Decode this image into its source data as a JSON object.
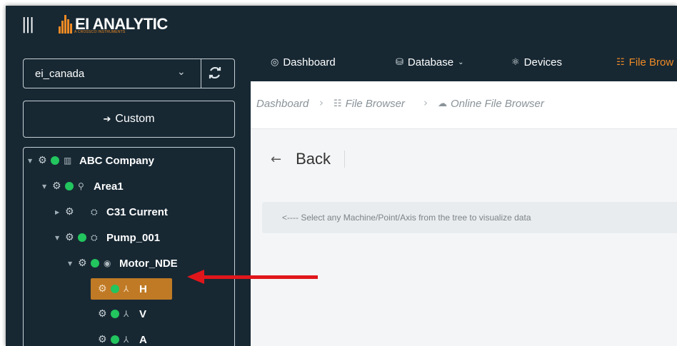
{
  "app": {
    "logo_text": "EI ANALYTIC",
    "logo_subtext": "A CROSSCO INSTRUMENTS",
    "brand_color": "#f08a24",
    "topbar_color": "#172833"
  },
  "sidebar": {
    "account_select": {
      "value": "ei_canada"
    },
    "custom_button": {
      "label": "Custom",
      "icon": "arrow-right-icon"
    },
    "tree": [
      {
        "label": "ABC Company",
        "icon": "building-icon",
        "status": "online",
        "expanded": true,
        "selected": false
      },
      {
        "label": "Area1",
        "icon": "location-pin-icon",
        "status": "online",
        "expanded": true,
        "selected": false
      },
      {
        "label": "C31 Current",
        "icon": "machine-icon",
        "status": "none",
        "expanded": false,
        "selected": false
      },
      {
        "label": "Pump_001",
        "icon": "machine-icon",
        "status": "online",
        "expanded": true,
        "selected": false
      },
      {
        "label": "Motor_NDE",
        "icon": "sensor-point-icon",
        "status": "online",
        "expanded": true,
        "selected": false
      },
      {
        "label": "H",
        "icon": "axis-icon",
        "status": "online",
        "expanded": false,
        "selected": true
      },
      {
        "label": "V",
        "icon": "axis-icon",
        "status": "online",
        "expanded": false,
        "selected": false
      },
      {
        "label": "A",
        "icon": "axis-icon",
        "status": "online",
        "expanded": false,
        "selected": false
      }
    ]
  },
  "navbar": {
    "items": [
      {
        "label": "Dashboard",
        "icon": "dashboard-icon",
        "active": false
      },
      {
        "label": "Database",
        "icon": "database-icon",
        "active": false,
        "has_dropdown": true
      },
      {
        "label": "Devices",
        "icon": "devices-icon",
        "active": false
      },
      {
        "label": "File Brow",
        "icon": "file-browser-icon",
        "active": true
      }
    ]
  },
  "breadcrumb": {
    "items": [
      {
        "label": "Dashboard",
        "icon": ""
      },
      {
        "label": "File Browser",
        "icon": "file-browser-icon"
      },
      {
        "label": "Online File Browser",
        "icon": "cloud-icon"
      }
    ]
  },
  "content": {
    "back_label": "Back",
    "info_message": "<---- Select any Machine/Point/Axis from the tree to visualize data"
  },
  "annotation": {
    "color": "#e0161b",
    "points_to": "H"
  }
}
